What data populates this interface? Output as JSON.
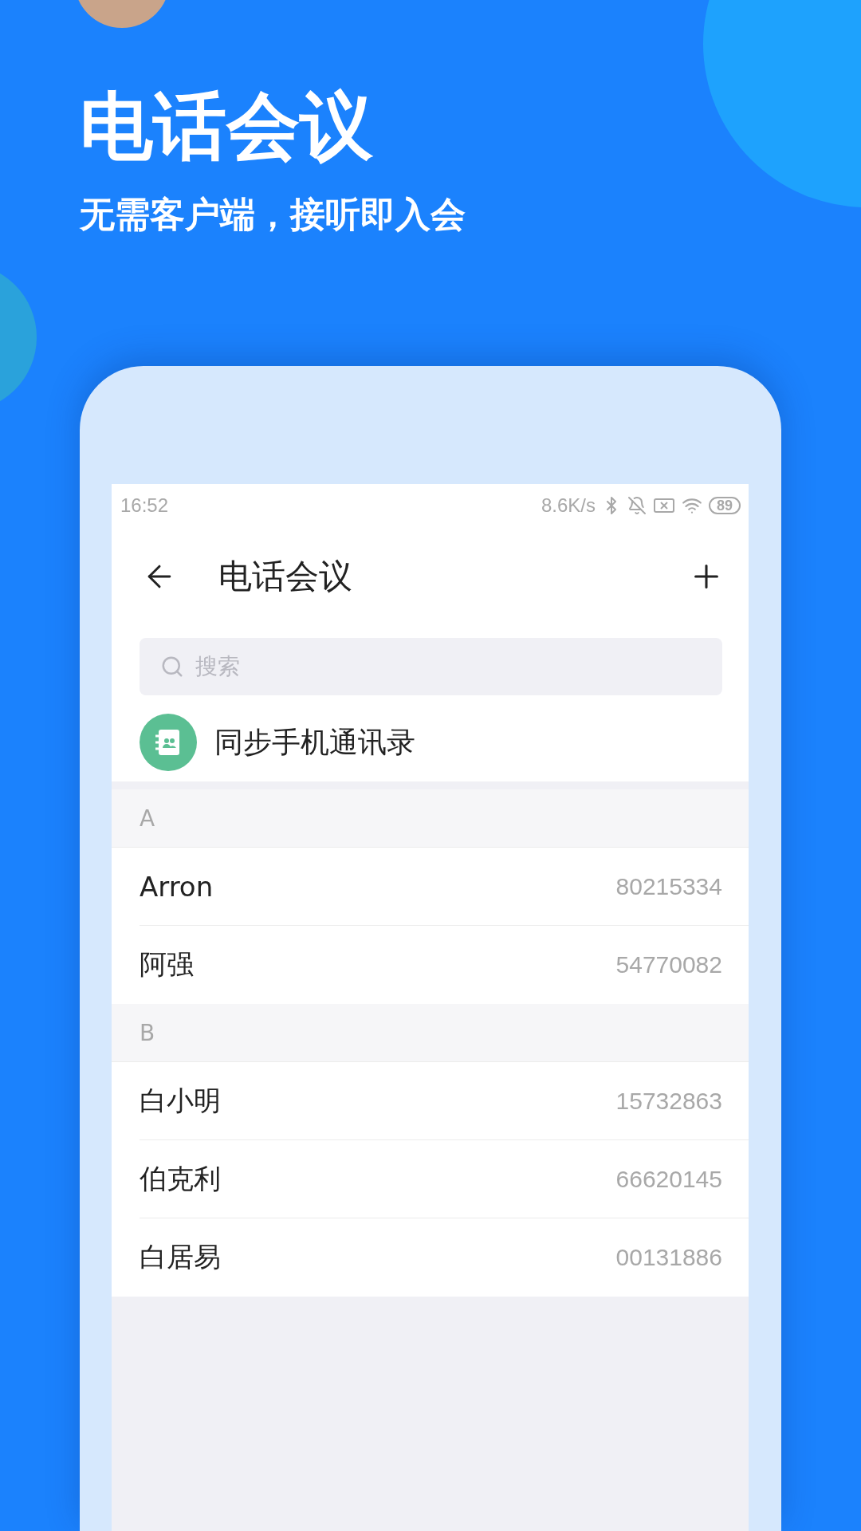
{
  "promo": {
    "title": "电话会议",
    "subtitle": "无需客户端，接听即入会"
  },
  "status_bar": {
    "time": "16:52",
    "speed": "8.6K/s",
    "battery": "89"
  },
  "header": {
    "title": "电话会议"
  },
  "search": {
    "placeholder": "搜索"
  },
  "sync": {
    "label": "同步手机通讯录"
  },
  "sections": [
    {
      "letter": "A",
      "contacts": [
        {
          "name": "Arron",
          "number": "80215334"
        },
        {
          "name": "阿强",
          "number": "54770082"
        }
      ]
    },
    {
      "letter": "B",
      "contacts": [
        {
          "name": "白小明",
          "number": "15732863"
        },
        {
          "name": "伯克利",
          "number": "66620145"
        },
        {
          "name": "白居易",
          "number": "00131886"
        }
      ]
    }
  ]
}
